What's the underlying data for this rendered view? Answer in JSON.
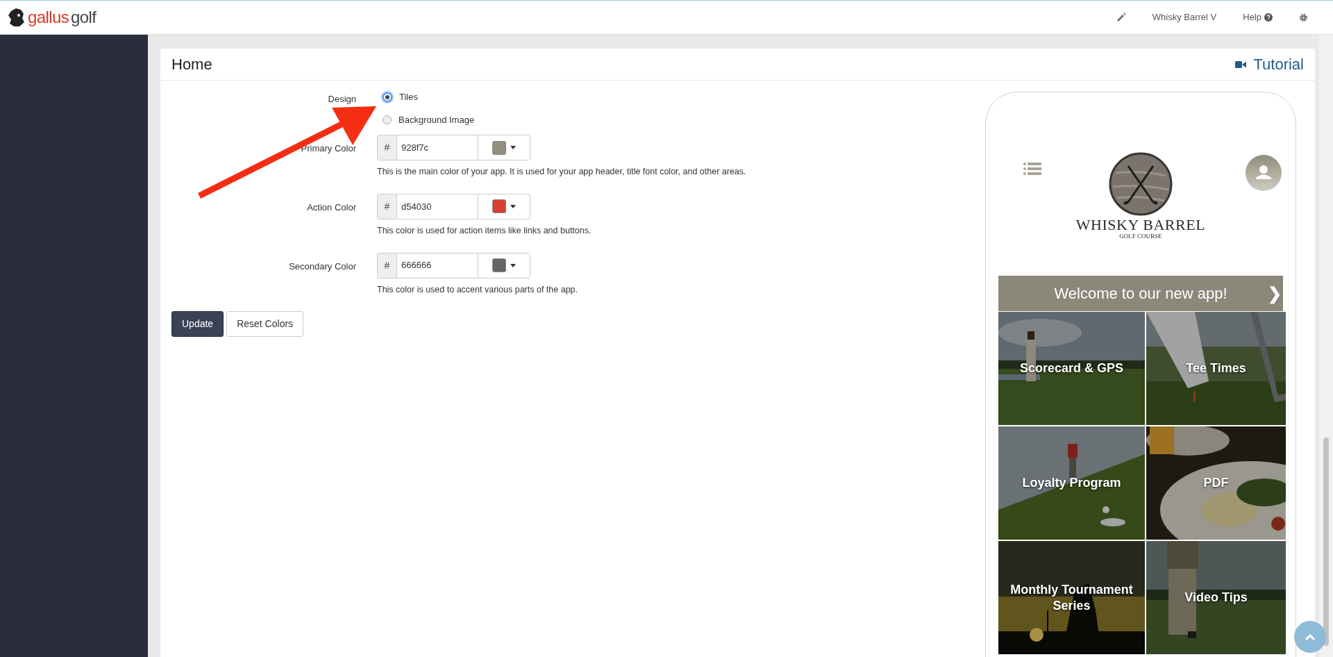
{
  "brand": {
    "first": "gallus",
    "second": "golf"
  },
  "topbar": {
    "account": "Whisky Barrel V",
    "help": "Help"
  },
  "page": {
    "title": "Home",
    "tutorial": "Tutorial"
  },
  "design": {
    "label": "Design",
    "options": [
      {
        "label": "Tiles",
        "selected": true
      },
      {
        "label": "Background Image",
        "selected": false
      }
    ]
  },
  "colors": [
    {
      "label": "Primary Color",
      "prefix": "#",
      "value": "928f7c",
      "color": "#928f7c",
      "help": "This is the main color of your app. It is used for your app header, title font color, and other areas."
    },
    {
      "label": "Action Color",
      "prefix": "#",
      "value": "d54030",
      "color": "#d54030",
      "help": "This color is used for action items like links and buttons."
    },
    {
      "label": "Secondary Color",
      "prefix": "#",
      "value": "666666",
      "color": "#666666",
      "help": "This color is used to accent various parts of the app."
    }
  ],
  "buttons": [
    {
      "label": "Update",
      "kind": "primary"
    },
    {
      "label": "Reset Colors",
      "kind": "default"
    }
  ],
  "preview": {
    "logo_title": "WHISKY BARREL",
    "logo_subtitle": "GOLF COURSE",
    "banner": "Welcome to our new app!",
    "banner_arrow": "❯",
    "tiles": [
      {
        "label": "Scorecard & GPS"
      },
      {
        "label": "Tee Times"
      },
      {
        "label": "Loyalty Program"
      },
      {
        "label": "PDF"
      },
      {
        "label": "Monthly Tournament Series"
      },
      {
        "label": "Video Tips"
      }
    ]
  }
}
